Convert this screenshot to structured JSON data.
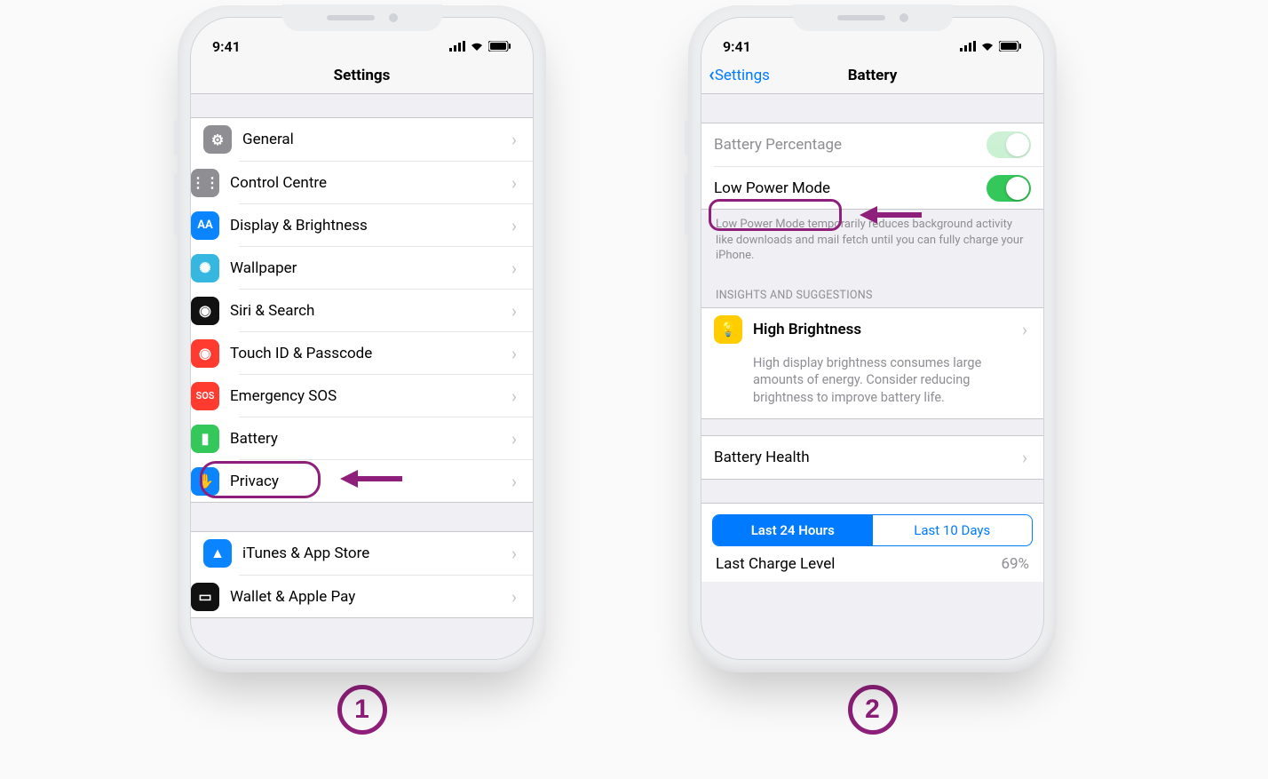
{
  "phone1": {
    "time": "9:41",
    "title": "Settings",
    "groups": [
      [
        {
          "id": "general",
          "label": "General",
          "iconClass": "ic-gray",
          "glyph": "⚙"
        },
        {
          "id": "control-centre",
          "label": "Control Centre",
          "iconClass": "ic-gray2",
          "glyph": "⋮⋮"
        },
        {
          "id": "display-brightness",
          "label": "Display & Brightness",
          "iconClass": "ic-blue",
          "glyph": "AA"
        },
        {
          "id": "wallpaper",
          "label": "Wallpaper",
          "iconClass": "ic-teal",
          "glyph": "✺"
        },
        {
          "id": "siri-search",
          "label": "Siri & Search",
          "iconClass": "ic-dark",
          "glyph": "◉"
        },
        {
          "id": "touch-id",
          "label": "Touch ID & Passcode",
          "iconClass": "ic-red",
          "glyph": "◉"
        },
        {
          "id": "emergency-sos",
          "label": "Emergency SOS",
          "iconClass": "ic-sos",
          "glyph": "SOS"
        },
        {
          "id": "battery",
          "label": "Battery",
          "iconClass": "ic-green",
          "glyph": "▮"
        },
        {
          "id": "privacy",
          "label": "Privacy",
          "iconClass": "ic-hand",
          "glyph": "✋"
        }
      ],
      [
        {
          "id": "itunes-app-store",
          "label": "iTunes & App Store",
          "iconClass": "ic-app",
          "glyph": "▲"
        },
        {
          "id": "wallet-apple-pay",
          "label": "Wallet & Apple Pay",
          "iconClass": "ic-wallet",
          "glyph": "▭"
        }
      ]
    ],
    "step": "1"
  },
  "phone2": {
    "time": "9:41",
    "back": "Settings",
    "title": "Battery",
    "batteryPercentage": "Battery Percentage",
    "lowPowerMode": "Low Power Mode",
    "lowPowerDesc": "Low Power Mode temporarily reduces background activity like downloads and mail fetch until you can fully charge your iPhone.",
    "insightsHeader": "INSIGHTS AND SUGGESTIONS",
    "highBrightness": "High Brightness",
    "highBrightnessDesc": "High display brightness consumes large amounts of energy. Consider reducing brightness to improve battery life.",
    "batteryHealth": "Battery Health",
    "seg": {
      "a": "Last 24 Hours",
      "b": "Last 10 Days"
    },
    "lastChargeLabel": "Last Charge Level",
    "lastChargeValue": "69%",
    "step": "2"
  }
}
